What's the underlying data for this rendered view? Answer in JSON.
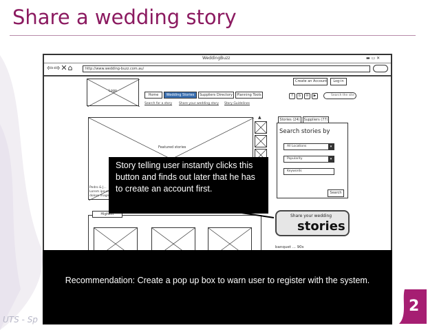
{
  "slide": {
    "title": "Share a wedding story",
    "number": "2",
    "footer_logo": "UTS - Sp",
    "colors": {
      "title": "#8b1a60",
      "accent": "#a61e72",
      "callout_bg": "#000000"
    }
  },
  "wireframe": {
    "app_title": "WeddingBuzz",
    "url": "http://www.wedding-buzz.com.au/",
    "nav_glyphs": "⇦⇨✕⌂",
    "header_buttons": {
      "create_account": "Create an Account",
      "login": "Log-in"
    },
    "logo_label": "Logo",
    "tabs": [
      {
        "label": "Home",
        "active": false
      },
      {
        "label": "Wedding Stories",
        "active": true
      },
      {
        "label": "Suppliers Directory",
        "active": false
      },
      {
        "label": "Planning Tools",
        "active": false
      }
    ],
    "sublinks": [
      "Search for a story",
      "Share your wedding story",
      "Story Guidelines"
    ],
    "social_icons": [
      "f",
      "b",
      "✉",
      "▶"
    ],
    "search_placeholder": "Search the site",
    "hero_label": "Featured stories",
    "hero_caption": "Pedro & J... Lorem ipsum... dolore magna...",
    "side_tabs": [
      "Stories (24)",
      "Suppliers (77)"
    ],
    "search_panel": {
      "title": "Search stories by",
      "location": "All Locations",
      "sort": "Popularity",
      "keywords": "Keywords",
      "button": "Search"
    },
    "share_button": {
      "small": "Share your wedding",
      "big": "stories"
    },
    "banquet_text": "banquet  ...  90s",
    "highest_tab": "Highest"
  },
  "callout": {
    "text": "Story telling user instantly clicks this button and finds out later that he has to create an account first."
  },
  "recommendation": {
    "text": "Recommendation: Create a pop up box to warn user to register with the system."
  }
}
